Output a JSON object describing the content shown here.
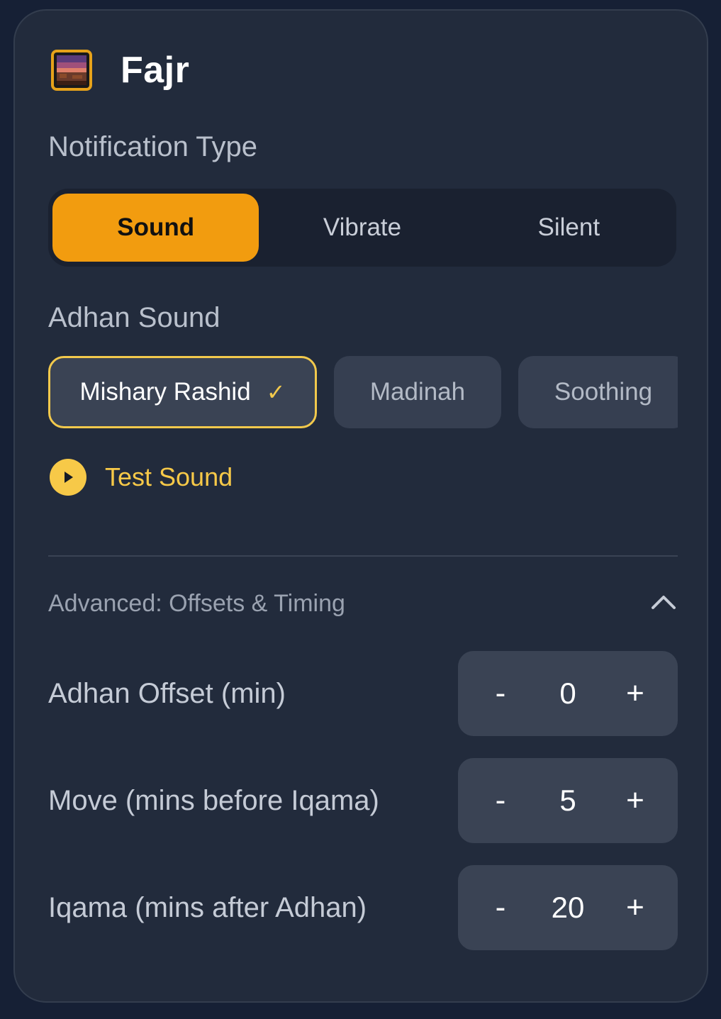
{
  "header": {
    "title": "Fajr",
    "icon": "sunrise-landscape-icon"
  },
  "notification": {
    "label": "Notification Type",
    "options": [
      "Sound",
      "Vibrate",
      "Silent"
    ],
    "selected": "Sound"
  },
  "adhan": {
    "label": "Adhan Sound",
    "options": [
      "Mishary Rashid",
      "Madinah",
      "Soothing"
    ],
    "selected": "Mishary Rashid",
    "check_glyph": "✓"
  },
  "test_sound": {
    "label": "Test Sound",
    "icon": "play-icon"
  },
  "advanced": {
    "label": "Advanced: Offsets & Timing",
    "expanded": true,
    "icon": "chevron-up-icon"
  },
  "steppers": [
    {
      "label": "Adhan Offset (min)",
      "value": "0",
      "minus": "-",
      "plus": "+"
    },
    {
      "label": "Move (mins before Iqama)",
      "value": "5",
      "minus": "-",
      "plus": "+"
    },
    {
      "label": "Iqama (mins after Adhan)",
      "value": "20",
      "minus": "-",
      "plus": "+"
    }
  ],
  "colors": {
    "background": "#162035",
    "card": "#222b3c",
    "accent_orange": "#f29c0f",
    "accent_yellow": "#f7c948",
    "control": "#3a4354"
  }
}
